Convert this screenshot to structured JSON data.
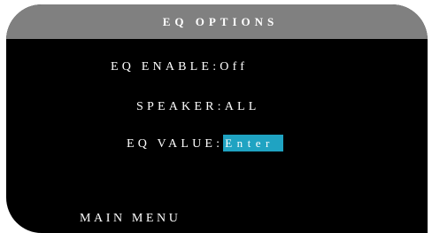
{
  "screen": {
    "title": "EQ OPTIONS"
  },
  "rows": [
    {
      "label": "EQ ENABLE",
      "separator": ":",
      "value": "Off"
    },
    {
      "label": "SPEAKER",
      "separator": ":",
      "value": "ALL"
    },
    {
      "label": "EQ VALUE",
      "separator": ":",
      "value": "Enter",
      "selected": true
    }
  ],
  "footer": {
    "main_menu_label": "MAIN MENU"
  },
  "colors": {
    "background": "#000000",
    "title_bar": "#808080",
    "text": "#ffffff",
    "selection_highlight": "#1fa3c2"
  }
}
